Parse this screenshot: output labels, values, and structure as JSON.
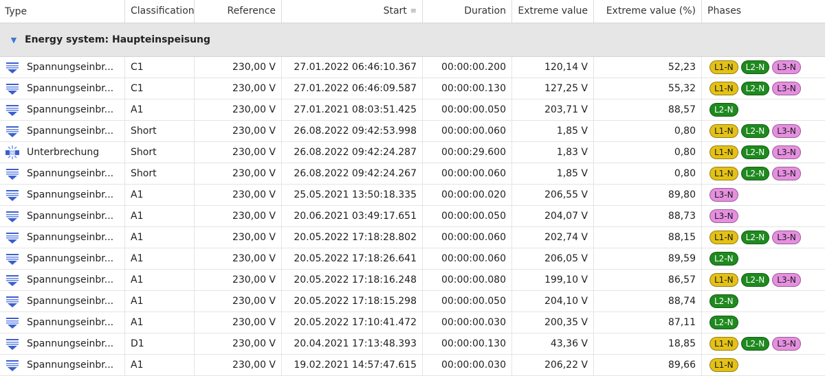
{
  "columns": {
    "type": "Type",
    "classification": "Classification",
    "reference": "Reference",
    "start": "Start",
    "duration": "Duration",
    "extreme_value": "Extreme value",
    "extreme_value_pct": "Extreme value (%)",
    "phases": "Phases"
  },
  "group": {
    "label": "Energy system: Haupteinspeisung"
  },
  "phase_colors": {
    "L1-N": {
      "bg": "#e3c116",
      "fg": "#1a1a1a"
    },
    "L2-N": {
      "bg": "#1f8a1f",
      "fg": "#ffffff"
    },
    "L3-N": {
      "bg": "#e58fe0",
      "fg": "#1a1a1a"
    }
  },
  "rows": [
    {
      "icon": "voltage-dip-icon",
      "type": "Spannungseinbr...",
      "classification": "C1",
      "reference": "230,00 V",
      "start": "27.01.2022 06:46:10.367",
      "duration": "00:00:00.200",
      "extreme": "120,14 V",
      "pct": "52,23",
      "phases": [
        "L1-N",
        "L2-N",
        "L3-N"
      ]
    },
    {
      "icon": "voltage-dip-icon",
      "type": "Spannungseinbr...",
      "classification": "C1",
      "reference": "230,00 V",
      "start": "27.01.2022 06:46:09.587",
      "duration": "00:00:00.130",
      "extreme": "127,25 V",
      "pct": "55,32",
      "phases": [
        "L1-N",
        "L2-N",
        "L3-N"
      ]
    },
    {
      "icon": "voltage-dip-icon",
      "type": "Spannungseinbr...",
      "classification": "A1",
      "reference": "230,00 V",
      "start": "27.01.2021 08:03:51.425",
      "duration": "00:00:00.050",
      "extreme": "203,71 V",
      "pct": "88,57",
      "phases": [
        "L2-N"
      ]
    },
    {
      "icon": "voltage-dip-icon",
      "type": "Spannungseinbr...",
      "classification": "Short",
      "reference": "230,00 V",
      "start": "26.08.2022 09:42:53.998",
      "duration": "00:00:00.060",
      "extreme": "1,85 V",
      "pct": "0,80",
      "phases": [
        "L1-N",
        "L2-N",
        "L3-N"
      ]
    },
    {
      "icon": "interruption-icon",
      "type": "Unterbrechung",
      "classification": "Short",
      "reference": "230,00 V",
      "start": "26.08.2022 09:42:24.287",
      "duration": "00:00:29.600",
      "extreme": "1,83 V",
      "pct": "0,80",
      "phases": [
        "L1-N",
        "L2-N",
        "L3-N"
      ]
    },
    {
      "icon": "voltage-dip-icon",
      "type": "Spannungseinbr...",
      "classification": "Short",
      "reference": "230,00 V",
      "start": "26.08.2022 09:42:24.267",
      "duration": "00:00:00.060",
      "extreme": "1,85 V",
      "pct": "0,80",
      "phases": [
        "L1-N",
        "L2-N",
        "L3-N"
      ]
    },
    {
      "icon": "voltage-dip-icon",
      "type": "Spannungseinbr...",
      "classification": "A1",
      "reference": "230,00 V",
      "start": "25.05.2021 13:50:18.335",
      "duration": "00:00:00.020",
      "extreme": "206,55 V",
      "pct": "89,80",
      "phases": [
        "L3-N"
      ]
    },
    {
      "icon": "voltage-dip-icon",
      "type": "Spannungseinbr...",
      "classification": "A1",
      "reference": "230,00 V",
      "start": "20.06.2021 03:49:17.651",
      "duration": "00:00:00.050",
      "extreme": "204,07 V",
      "pct": "88,73",
      "phases": [
        "L3-N"
      ]
    },
    {
      "icon": "voltage-dip-icon",
      "type": "Spannungseinbr...",
      "classification": "A1",
      "reference": "230,00 V",
      "start": "20.05.2022 17:18:28.802",
      "duration": "00:00:00.060",
      "extreme": "202,74 V",
      "pct": "88,15",
      "phases": [
        "L1-N",
        "L2-N",
        "L3-N"
      ]
    },
    {
      "icon": "voltage-dip-icon",
      "type": "Spannungseinbr...",
      "classification": "A1",
      "reference": "230,00 V",
      "start": "20.05.2022 17:18:26.641",
      "duration": "00:00:00.060",
      "extreme": "206,05 V",
      "pct": "89,59",
      "phases": [
        "L2-N"
      ]
    },
    {
      "icon": "voltage-dip-icon",
      "type": "Spannungseinbr...",
      "classification": "A1",
      "reference": "230,00 V",
      "start": "20.05.2022 17:18:16.248",
      "duration": "00:00:00.080",
      "extreme": "199,10 V",
      "pct": "86,57",
      "phases": [
        "L1-N",
        "L2-N",
        "L3-N"
      ]
    },
    {
      "icon": "voltage-dip-icon",
      "type": "Spannungseinbr...",
      "classification": "A1",
      "reference": "230,00 V",
      "start": "20.05.2022 17:18:15.298",
      "duration": "00:00:00.050",
      "extreme": "204,10 V",
      "pct": "88,74",
      "phases": [
        "L2-N"
      ]
    },
    {
      "icon": "voltage-dip-icon",
      "type": "Spannungseinbr...",
      "classification": "A1",
      "reference": "230,00 V",
      "start": "20.05.2022 17:10:41.472",
      "duration": "00:00:00.030",
      "extreme": "200,35 V",
      "pct": "87,11",
      "phases": [
        "L2-N"
      ]
    },
    {
      "icon": "voltage-dip-icon",
      "type": "Spannungseinbr...",
      "classification": "D1",
      "reference": "230,00 V",
      "start": "20.04.2021 17:13:48.393",
      "duration": "00:00:00.130",
      "extreme": "43,36 V",
      "pct": "18,85",
      "phases": [
        "L1-N",
        "L2-N",
        "L3-N"
      ]
    },
    {
      "icon": "voltage-dip-icon",
      "type": "Spannungseinbr...",
      "classification": "A1",
      "reference": "230,00 V",
      "start": "19.02.2021 14:57:47.615",
      "duration": "00:00:00.030",
      "extreme": "206,22 V",
      "pct": "89,66",
      "phases": [
        "L1-N"
      ]
    }
  ]
}
